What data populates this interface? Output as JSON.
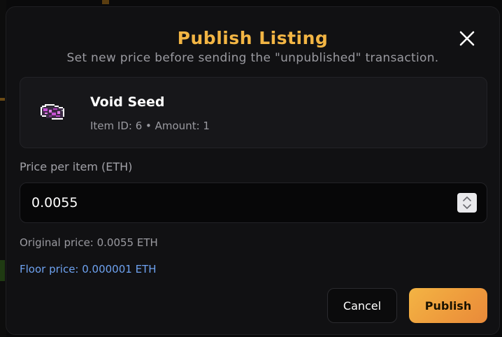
{
  "modal": {
    "title": "Publish Listing",
    "subtitle": "Set new price before sending the \"unpublished\" transaction.",
    "close_icon": "close-icon"
  },
  "item": {
    "name": "Void Seed",
    "meta": "Item ID: 6 • Amount: 1",
    "icon": "void-seed-icon"
  },
  "price_field": {
    "label": "Price per item (ETH)",
    "value": "0.0055",
    "stepper_icon": "stepper-icon"
  },
  "info": {
    "original_price": "Original price: 0.0055 ETH",
    "floor_price": "Floor price: 0.000001 ETH"
  },
  "actions": {
    "cancel_label": "Cancel",
    "publish_label": "Publish"
  },
  "colors": {
    "accent": "#f2b544",
    "floor_text": "#6ea2f0",
    "modal_bg": "#111113"
  }
}
